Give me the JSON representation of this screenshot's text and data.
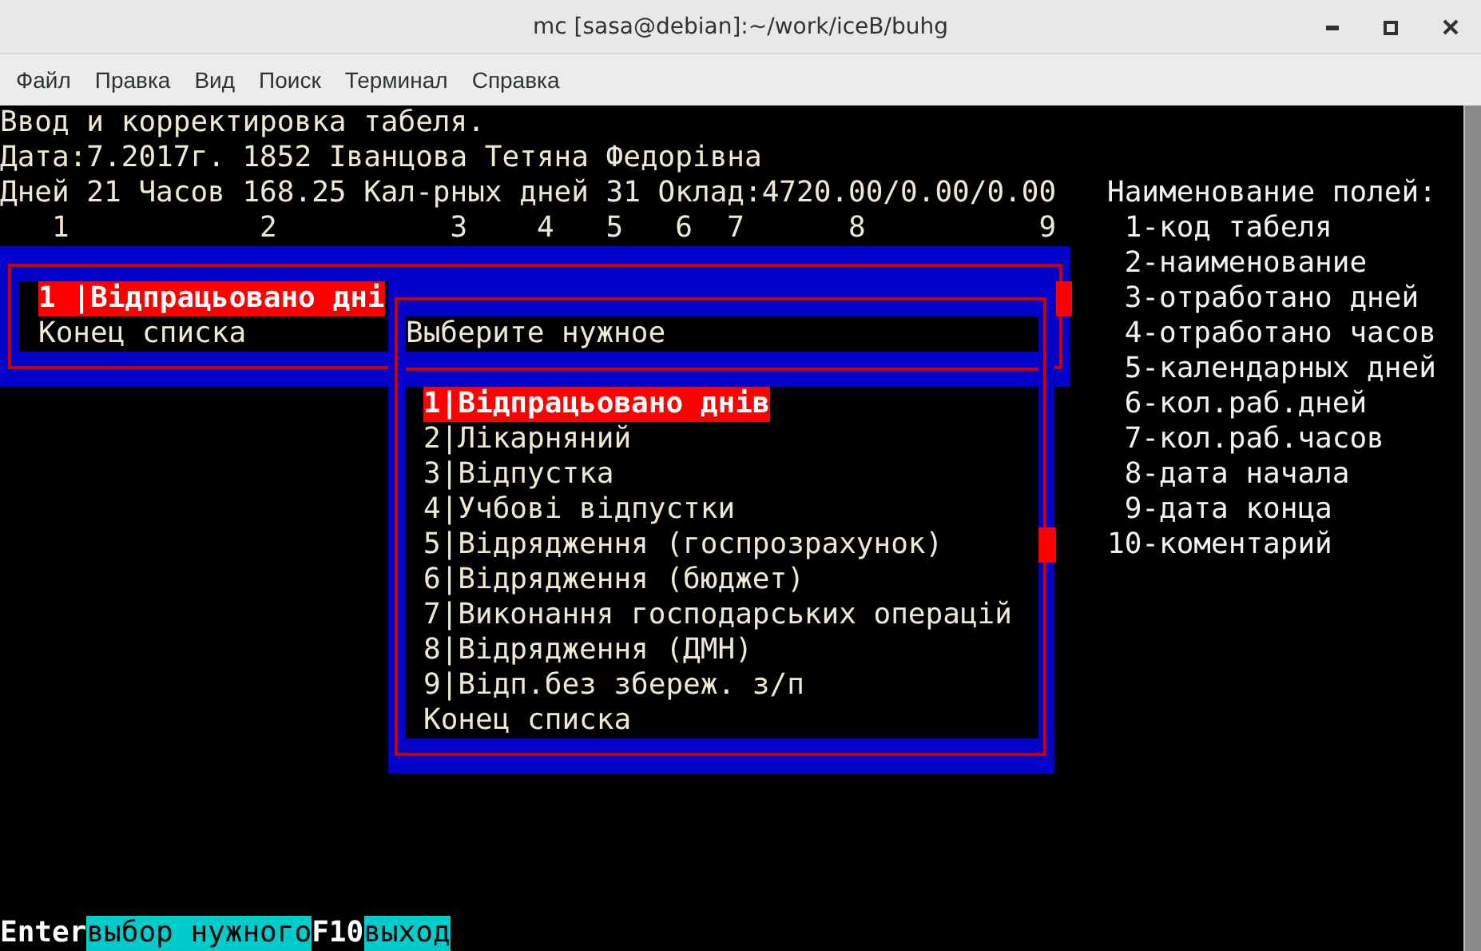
{
  "window": {
    "title": "mc [sasa@debian]:~/work/iceB/buhg"
  },
  "menu": [
    "Файл",
    "Правка",
    "Вид",
    "Поиск",
    "Терминал",
    "Справка"
  ],
  "screen": {
    "header_lines": [
      "Ввод и корректировка табеля.",
      "Дата:7.2017г. 1852 Іванцова Тетяна Федорівна"
    ],
    "summary": "Дней 21 Часов 168.25 Кал-рных дней 31 Оклад:4720.00/0.00/0.00",
    "column_numbers": "   1           2          3    4   5   6  7      8          9",
    "legend": {
      "title": "Наименование полей:",
      "items": [
        " 1-код табеля",
        " 2-наименование",
        " 3-отработано дней",
        " 4-отработано часов",
        " 5-календарных дней",
        " 6-кол.раб.дней",
        " 7-кол.раб.часов",
        " 8-дата начала",
        " 9-дата конца",
        "10-коментарий"
      ]
    }
  },
  "table_list": {
    "rows": [
      {
        "text": "1 |Відпрацьовано дні",
        "selected": true
      },
      {
        "text": "Конец списка",
        "selected": false
      }
    ]
  },
  "choice_dialog": {
    "title": "Выберите нужное",
    "items": [
      {
        "text": "1|Відпрацьовано днів",
        "selected": true
      },
      {
        "text": "2|Лікарняний",
        "selected": false
      },
      {
        "text": "3|Відпустка",
        "selected": false
      },
      {
        "text": "4|Учбові відпустки",
        "selected": false
      },
      {
        "text": "5|Відрядження (госпрозрахунок)",
        "selected": false
      },
      {
        "text": "6|Відрядження (бюджет)",
        "selected": false
      },
      {
        "text": "7|Виконання господарських операцій",
        "selected": false
      },
      {
        "text": "8|Відрядження (ДМН)",
        "selected": false
      },
      {
        "text": "9|Відп.без збереж. з/п",
        "selected": false
      },
      {
        "text": "Конец списка",
        "selected": false
      }
    ]
  },
  "status_bar": [
    {
      "key": "Enter",
      "action": "выбор нужного"
    },
    {
      "key": "F10",
      "action": "выход"
    }
  ]
}
